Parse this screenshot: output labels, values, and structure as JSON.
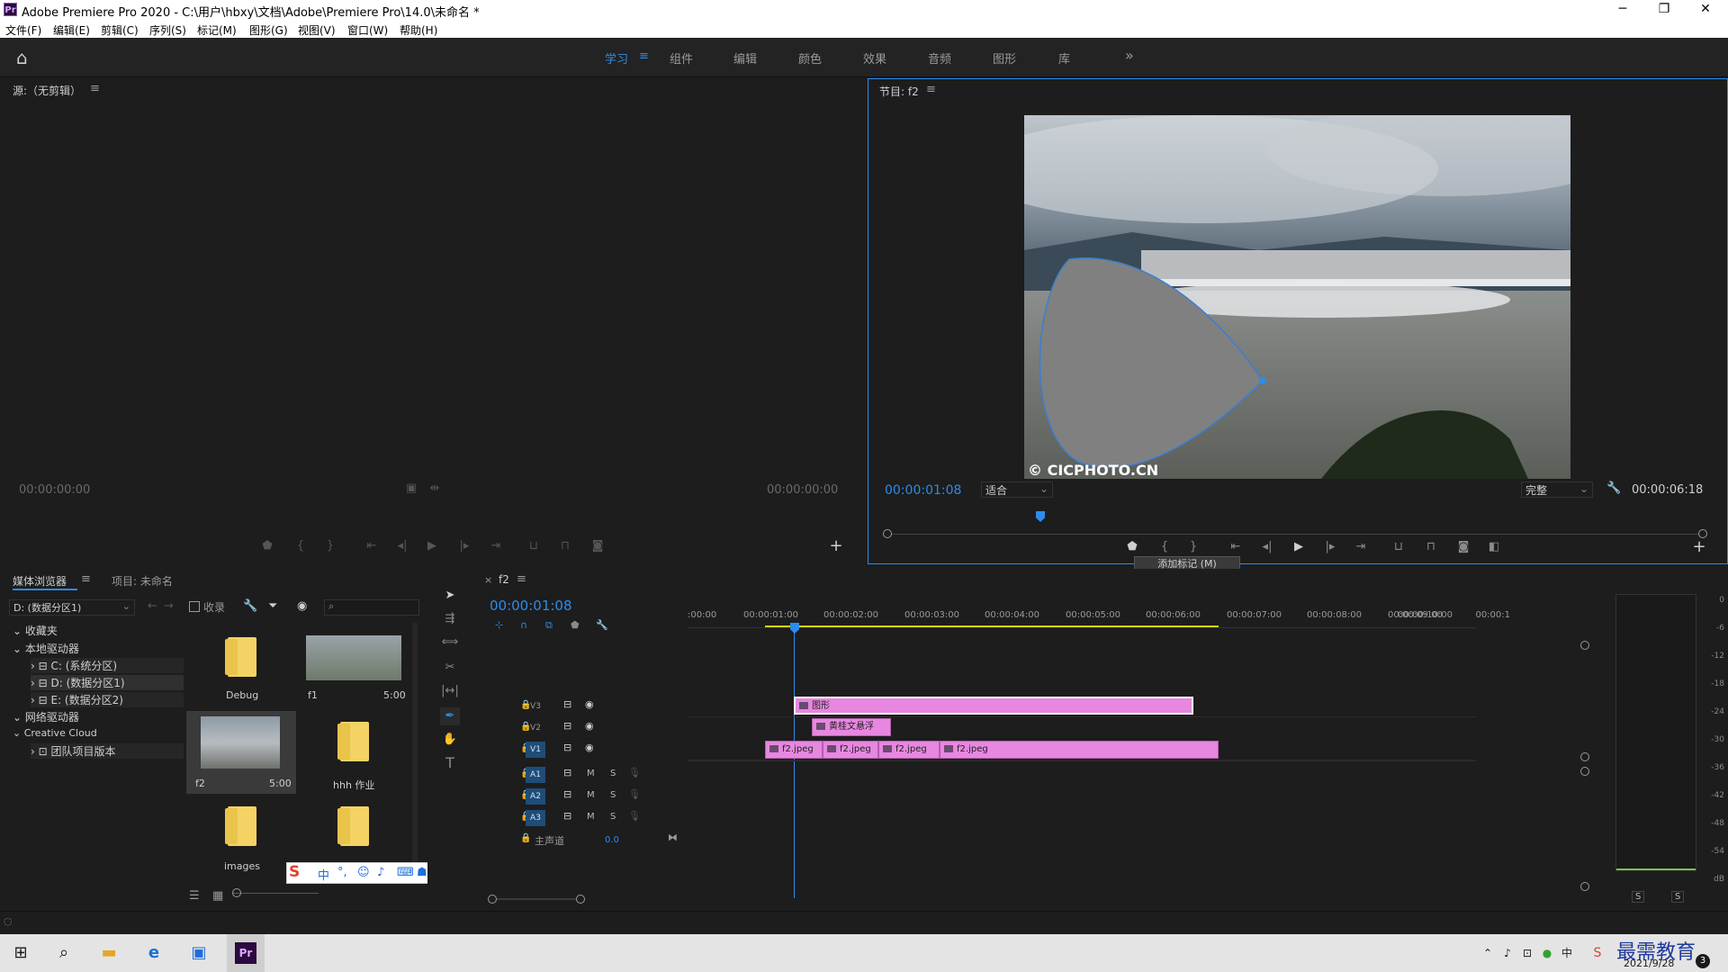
{
  "titlebar": {
    "title": "Adobe Premiere Pro 2020 - C:\\用户\\hbxy\\文档\\Adobe\\Premiere Pro\\14.0\\未命名 *",
    "min": "─",
    "max": "❐",
    "close": "✕"
  },
  "menu": [
    "文件(F)",
    "编辑(E)",
    "剪辑(C)",
    "序列(S)",
    "标记(M)",
    "图形(G)",
    "视图(V)",
    "窗口(W)",
    "帮助(H)"
  ],
  "workspaces": [
    "学习",
    "组件",
    "编辑",
    "颜色",
    "效果",
    "音频",
    "图形",
    "库"
  ],
  "more": "»",
  "source": {
    "title": "源:（无剪辑）",
    "tc_left": "00:00:00:00",
    "tc_right": "00:00:00:00"
  },
  "program": {
    "title": "节目: f2",
    "tc_current": "00:00:01:08",
    "fit": "适合",
    "quality": "完整",
    "tc_duration": "00:00:06:18",
    "watermark": "© CICPHOTO.CN",
    "tooltip": "添加标记 (M)"
  },
  "media": {
    "tab1": "媒体浏览器",
    "tab2": "项目: 未命名",
    "drive": "D: (数据分区1)",
    "collect": "收录",
    "tree": [
      "收藏夹",
      "本地驱动器",
      "C: (系统分区)",
      "D: (数据分区1)",
      "E: (数据分区2)",
      "网络驱动器",
      "Creative Cloud",
      "团队项目版本"
    ],
    "items": [
      {
        "name": "Debug",
        "dur": ""
      },
      {
        "name": "f1",
        "dur": "5:00"
      },
      {
        "name": "f2",
        "dur": "5:00"
      },
      {
        "name": "hhh 作业",
        "dur": ""
      },
      {
        "name": "images",
        "dur": ""
      },
      {
        "name": "",
        "dur": ""
      }
    ]
  },
  "timeline": {
    "tab": "f2",
    "tc": "00:00:01:08",
    "ruler": [
      ":00:00",
      "00:00:01:00",
      "00:00:02:00",
      "00:00:03:00",
      "00:00:04:00",
      "00:00:05:00",
      "00:00:06:00",
      "00:00:07:00",
      "00:00:08:00",
      "00:00:09:00",
      "00:00:10:00",
      "00:00:1"
    ],
    "tracks": [
      "V3",
      "V2",
      "V1",
      "A1",
      "A2",
      "A3"
    ],
    "master": "主声道",
    "master_val": "0.0",
    "m": "M",
    "s": "S",
    "clips": {
      "v3": "图形",
      "v2": "黄桂文悬浮",
      "v1": [
        "f2.jpeg",
        "f2.jpeg",
        "f2.jpeg",
        "f2.jpeg"
      ]
    }
  },
  "meter": {
    "ticks": [
      "0",
      "-6",
      "-12",
      "-18",
      "-24",
      "-30",
      "-36",
      "-42",
      "-48",
      "-54",
      "dB"
    ],
    "s1": "S",
    "s2": "S"
  },
  "taskbar": {
    "date": "2021/9/28",
    "brand": "最需教育",
    "notif": "3"
  },
  "colors": {
    "accent": "#2d8ceb",
    "clip": "#e787e0",
    "work_area": "#d4d400"
  }
}
